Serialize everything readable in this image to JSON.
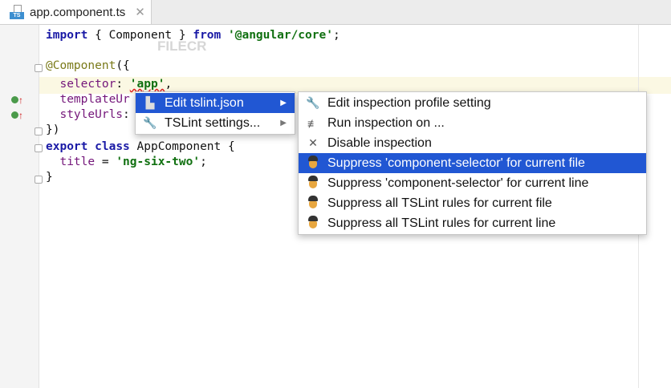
{
  "tab": {
    "title": "app.component.ts",
    "icon": "TS"
  },
  "watermark": "FILECR",
  "code": {
    "l1": [
      "import",
      " { Component } ",
      "from",
      " ",
      "'@angular/core'",
      ";"
    ],
    "l3": [
      "@Component",
      "({"
    ],
    "l4": [
      "  selector",
      ": ",
      "'app'",
      ","
    ],
    "l5": [
      "  templateUr"
    ],
    "l6": [
      "  styleUrls",
      ":"
    ],
    "l7": "})",
    "l8": [
      "export",
      " ",
      "class",
      " AppComponent {"
    ],
    "l9": [
      "  title",
      " = ",
      "'ng-six-two'",
      ";"
    ],
    "l10": "}"
  },
  "menu": {
    "items": [
      {
        "label": "Edit tslint.json"
      },
      {
        "label": "TSLint settings..."
      }
    ]
  },
  "submenu": {
    "items": [
      {
        "label": "Edit inspection profile setting"
      },
      {
        "label": "Run inspection on ..."
      },
      {
        "label": "Disable inspection"
      },
      {
        "label": "Suppress 'component-selector' for current file"
      },
      {
        "label": "Suppress 'component-selector' for current line"
      },
      {
        "label": "Suppress all TSLint rules for current file"
      },
      {
        "label": "Suppress all TSLint rules for current line"
      }
    ]
  },
  "colors": {
    "selection": "#2157d3"
  }
}
